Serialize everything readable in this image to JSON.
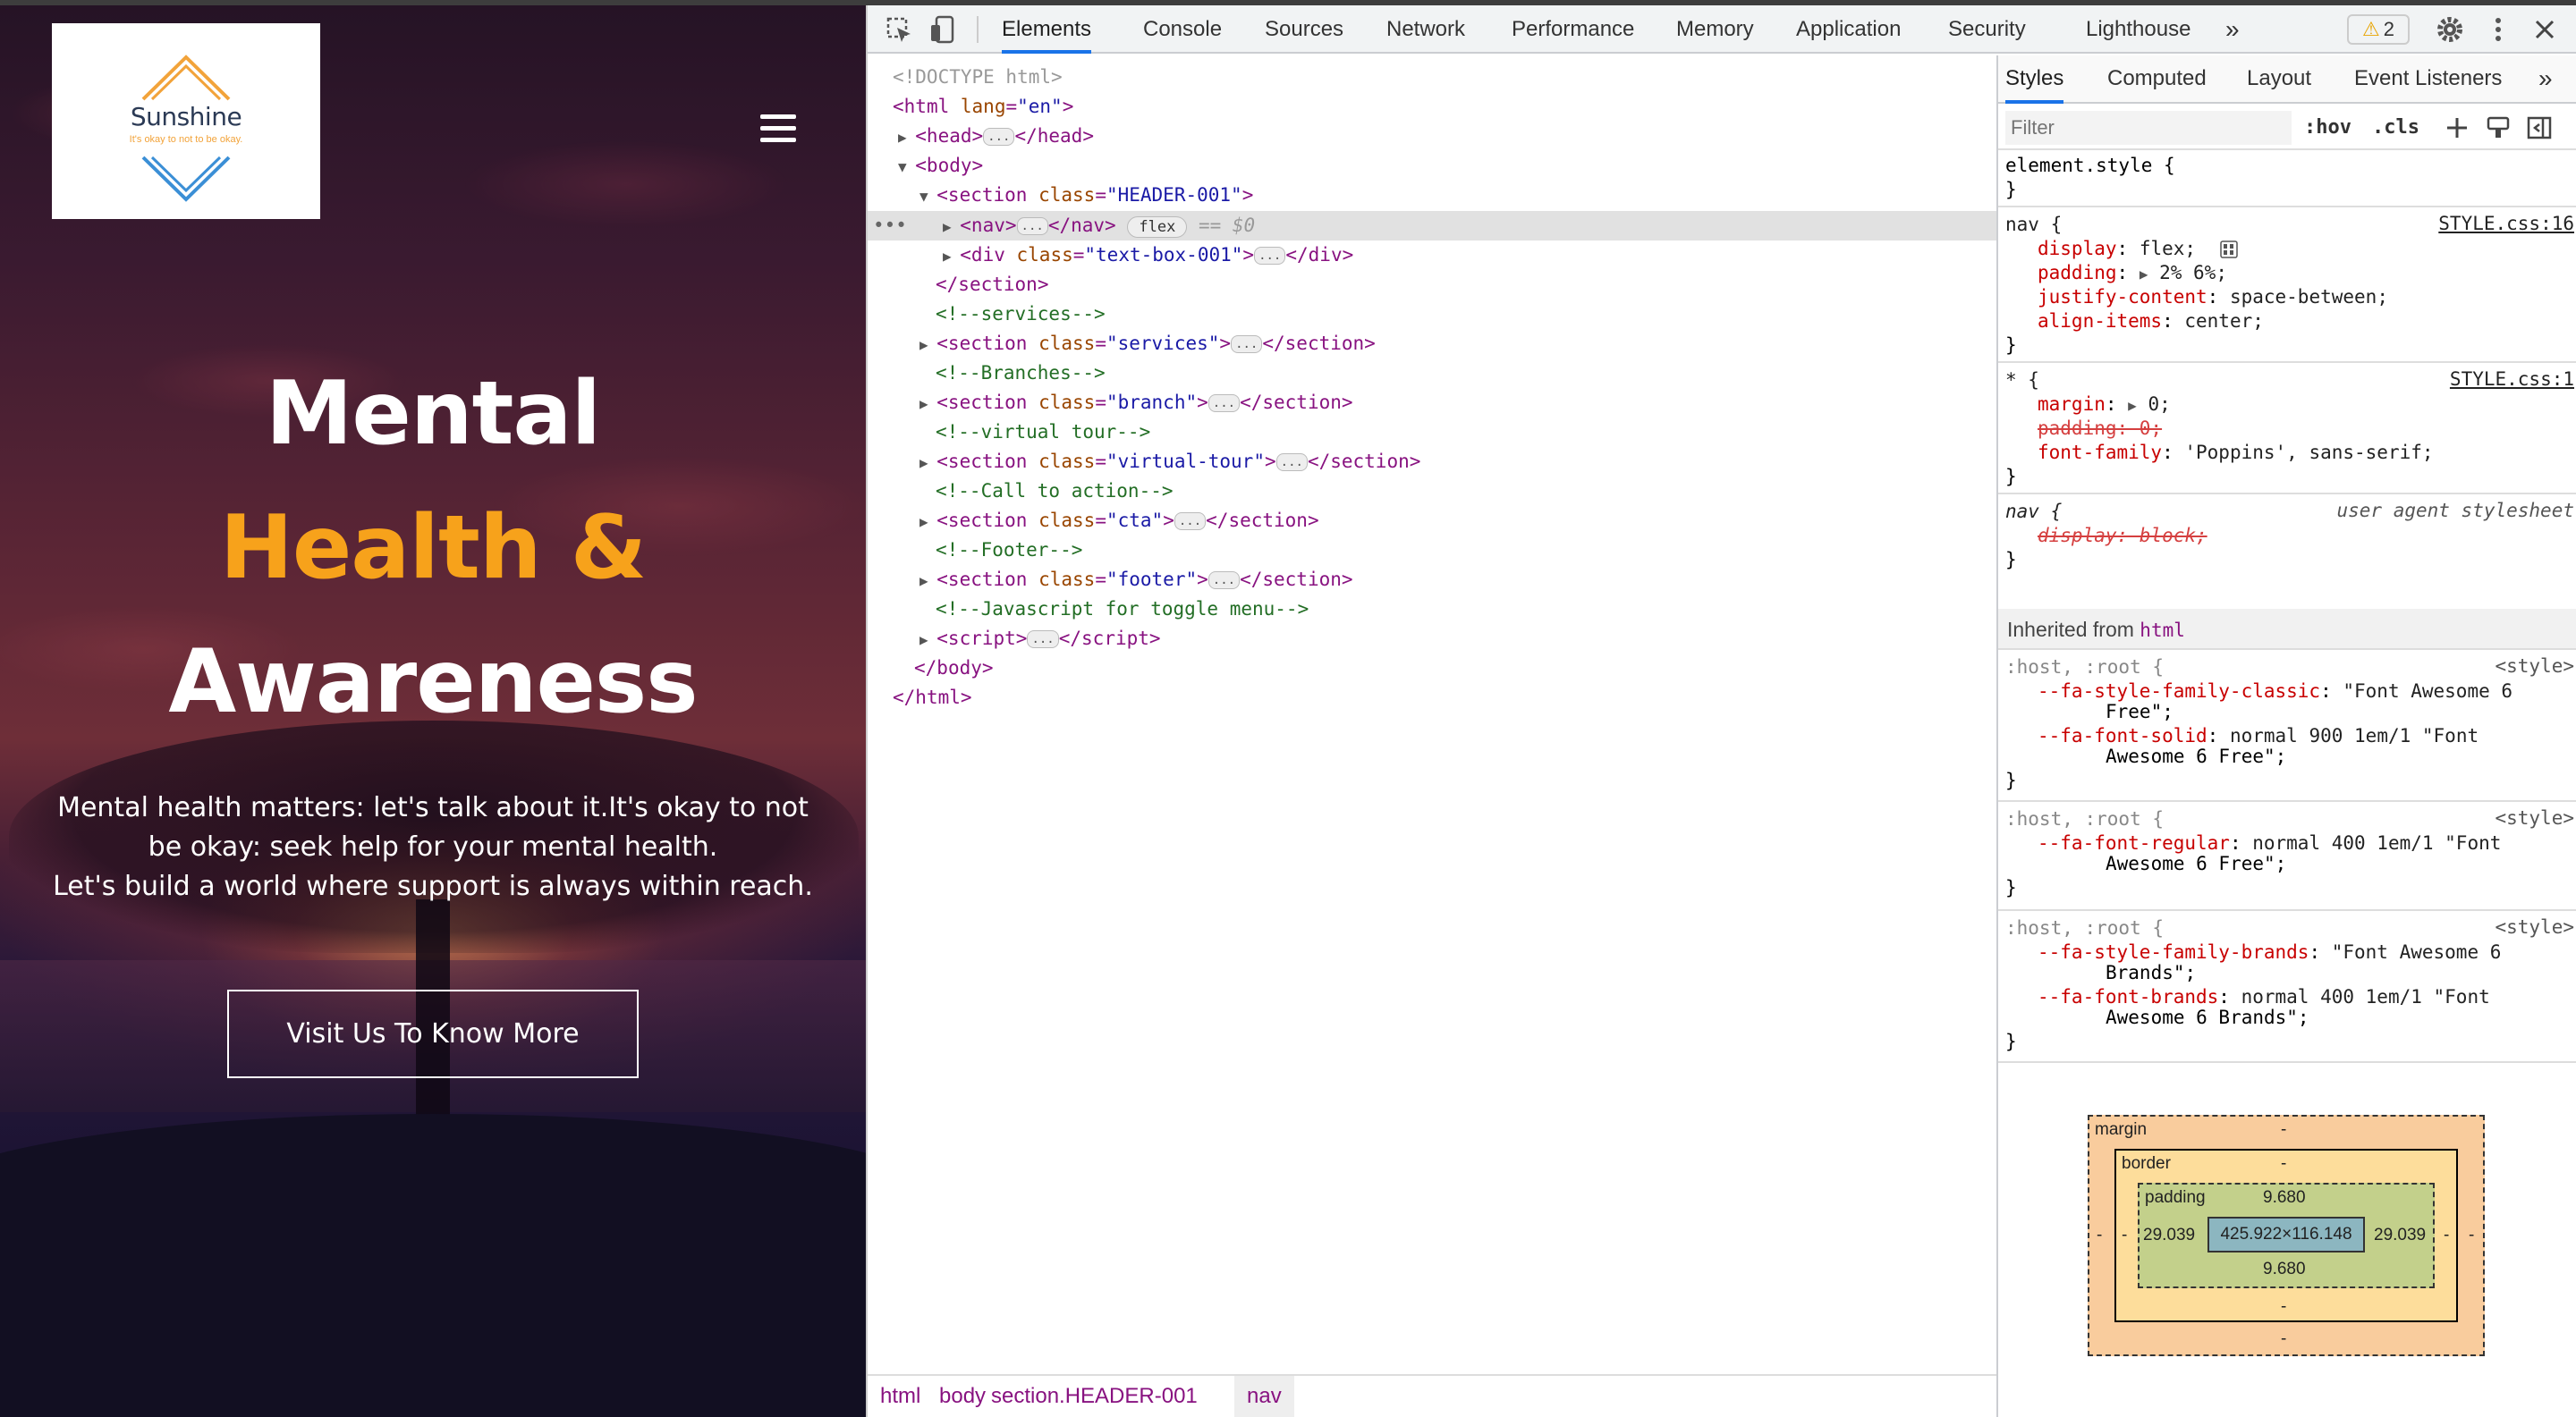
{
  "site": {
    "logo": {
      "title": "Sunshine",
      "tagline": "It's okay to not to be okay."
    },
    "hero": {
      "line1": "Mental",
      "line2": "Health &",
      "line3": "Awareness",
      "desc1": "Mental health matters: let's talk about it.It's okay to not",
      "desc2": "be okay: seek help for your mental health.",
      "desc3": "Let's build a world where support is always within reach.",
      "button": "Visit Us To Know More"
    },
    "colors": {
      "accent": "#f7a21b",
      "logo_title": "#2b3a55"
    }
  },
  "devtools": {
    "tabs": [
      "Elements",
      "Console",
      "Sources",
      "Network",
      "Performance",
      "Memory",
      "Application",
      "Security",
      "Lighthouse"
    ],
    "more": "»",
    "warnings": "2",
    "tree": {
      "doctype": "<!DOCTYPE html>",
      "html_open": "html",
      "html_attr": "lang",
      "html_val": "\"en\"",
      "head": "head",
      "body": "body",
      "section": "section",
      "class_attr": "class",
      "header_cls": "\"HEADER-001\"",
      "nav": "nav",
      "flex_pill": "flex",
      "eq": "== $0",
      "div": "div",
      "textbox_cls": "\"text-box-001\"",
      "c_services": "<!--services-->",
      "services_cls": "\"services\"",
      "c_branches": "<!--Branches-->",
      "branch_cls": "\"branch\"",
      "c_virtual": "<!--virtual tour-->",
      "virtual_cls": "\"virtual-tour\"",
      "c_cta": "<!--Call to action-->",
      "cta_cls": "\"cta\"",
      "c_footer": "<!--Footer-->",
      "footer_cls": "\"footer\"",
      "c_js": "<!--Javascript for toggle menu-->",
      "script": "script",
      "dots": "..."
    },
    "breadcrumbs": [
      "html",
      "body",
      "section.HEADER-001",
      "nav"
    ],
    "styles": {
      "tabs": [
        "Styles",
        "Computed",
        "Layout",
        "Event Listeners"
      ],
      "filter_placeholder": "Filter",
      "hov": ":hov",
      "cls": ".cls",
      "element_style": "element.style {",
      "nav_rule": {
        "selector": "nav {",
        "source": "STYLE.css:16",
        "props": [
          {
            "name": "display",
            "value": "flex;"
          },
          {
            "name": "padding",
            "value": "2% 6%;"
          },
          {
            "name": "justify-content",
            "value": "space-between;"
          },
          {
            "name": "align-items",
            "value": "center;"
          }
        ]
      },
      "star_rule": {
        "selector": "* {",
        "source": "STYLE.css:1",
        "margin": {
          "name": "margin",
          "value": "0;"
        },
        "padding": "padding: 0;",
        "font": {
          "name": "font-family",
          "value": "'Poppins', sans-serif;"
        }
      },
      "ua_rule": {
        "selector": "nav {",
        "source": "user agent stylesheet",
        "decl": "display: block;"
      },
      "inherited_label": "Inherited from",
      "inherited_tag": "html",
      "root1": {
        "selector": ":host, :root {",
        "source": "<style>",
        "l1n": "--fa-style-family-classic",
        "l1v": "\"Font Awesome 6",
        "l1c": "Free\";",
        "l2n": "--fa-font-solid",
        "l2v": "normal 900 1em/1 \"Font",
        "l2c": "Awesome 6 Free\";"
      },
      "root2": {
        "selector": ":host, :root {",
        "source": "<style>",
        "l1n": "--fa-font-regular",
        "l1v": "normal 400 1em/1 \"Font",
        "l1c": "Awesome 6 Free\";"
      },
      "root3": {
        "selector": ":host, :root {",
        "source": "<style>",
        "l1n": "--fa-style-family-brands",
        "l1v": "\"Font Awesome 6",
        "l1c": "Brands\";",
        "l2n": "--fa-font-brands",
        "l2v": "normal 400 1em/1 \"Font",
        "l2c": "Awesome 6 Brands\";"
      },
      "close_brace": "}",
      "box_model": {
        "margin_label": "margin",
        "border_label": "border",
        "padding_label": "padding",
        "dash": "-",
        "padding_top": "9.680",
        "padding_bottom": "9.680",
        "padding_left": "29.039",
        "padding_right": "29.039",
        "content": "425.922×116.148"
      }
    }
  }
}
